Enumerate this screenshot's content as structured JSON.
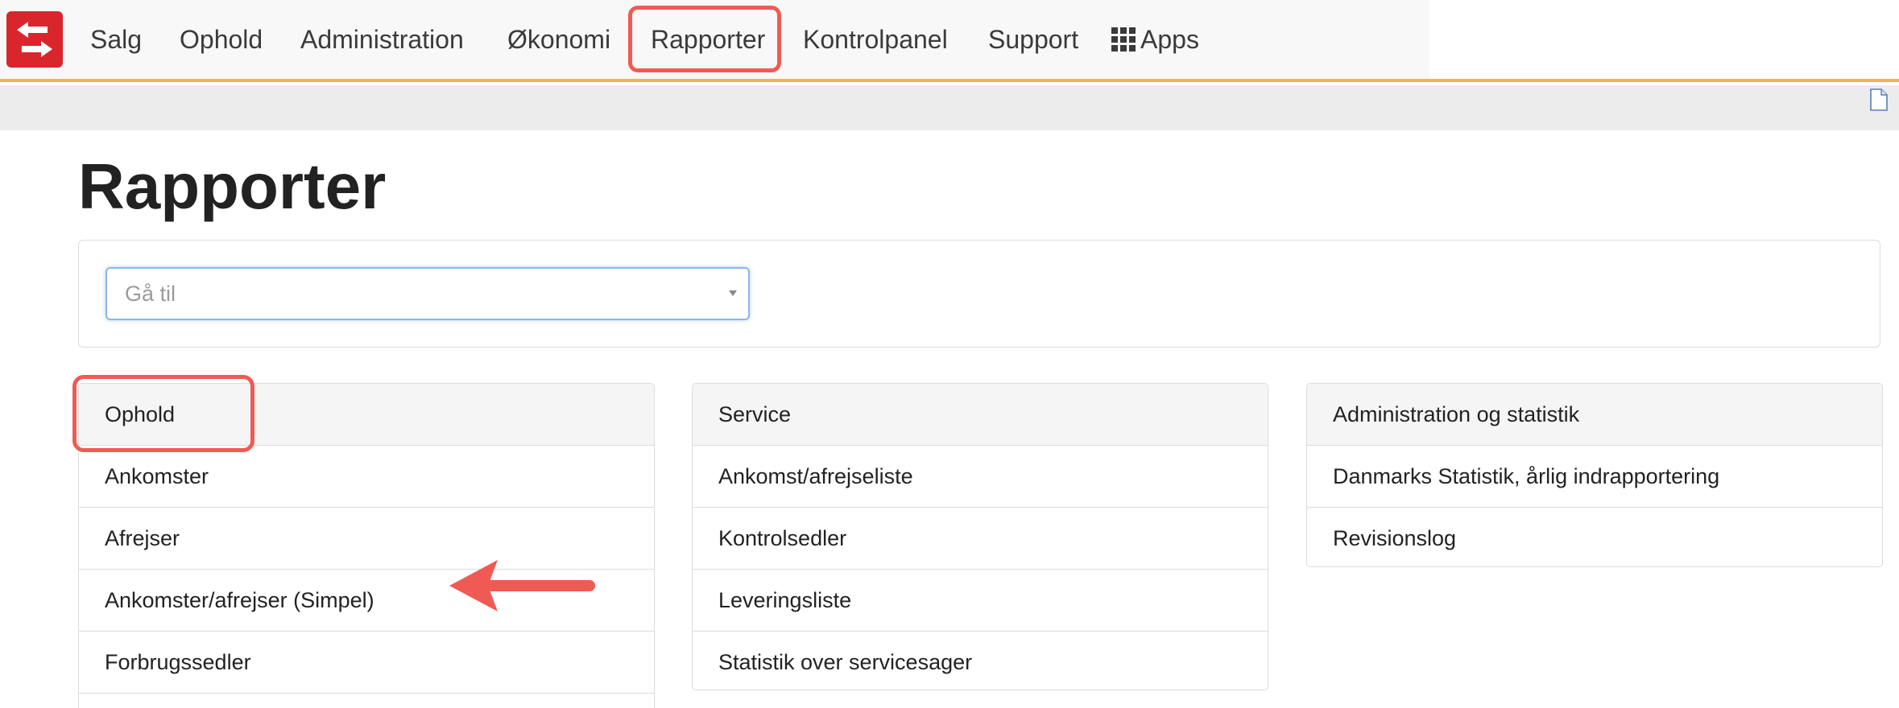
{
  "nav": {
    "items": [
      {
        "label": "Salg"
      },
      {
        "label": "Ophold"
      },
      {
        "label": "Administration"
      },
      {
        "label": "Økonomi"
      },
      {
        "label": "Rapporter",
        "active": true
      },
      {
        "label": "Kontrolpanel"
      },
      {
        "label": "Support"
      },
      {
        "label": "Apps",
        "icon": "grid-icon"
      }
    ],
    "accent_color": "#f2b449",
    "logo_color": "#d9262c",
    "highlight_color": "#ef5b54"
  },
  "page": {
    "title": "Rapporter"
  },
  "goto": {
    "placeholder": "Gå til"
  },
  "panels": [
    {
      "heading": "Ophold",
      "items": [
        "Ankomster",
        "Afrejser",
        "Ankomster/afrejser (Simpel)",
        "Forbrugssedler"
      ]
    },
    {
      "heading": "Service",
      "items": [
        "Ankomst/afrejseliste",
        "Kontrolsedler",
        "Leveringsliste",
        "Statistik over servicesager"
      ]
    },
    {
      "heading": "Administration og statistik",
      "items": [
        "Danmarks Statistik, årlig indrapportering",
        "Revisionslog"
      ]
    }
  ]
}
